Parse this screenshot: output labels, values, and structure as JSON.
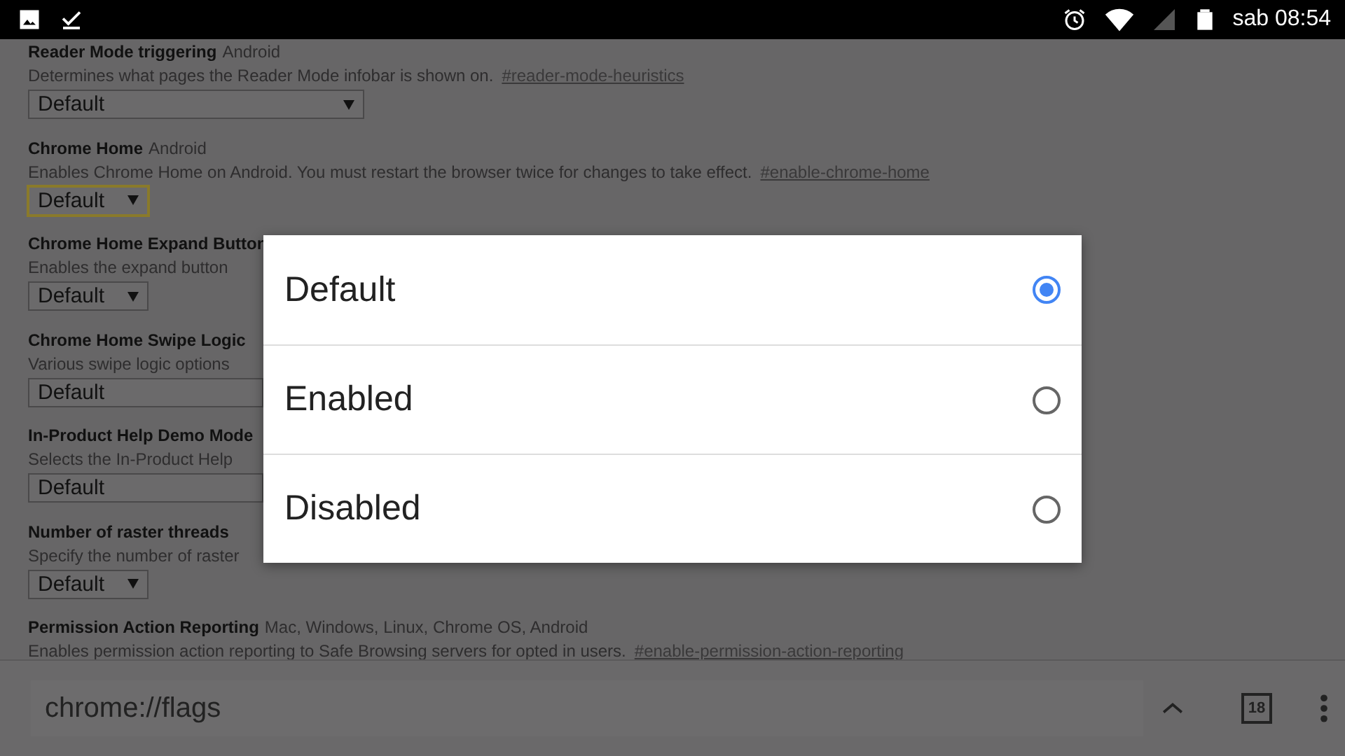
{
  "status_bar": {
    "time": "sab 08:54"
  },
  "flags": [
    {
      "title": "Reader Mode triggering",
      "platforms": "Android",
      "description": "Determines what pages the Reader Mode infobar is shown on.",
      "link": "#reader-mode-heuristics",
      "value": "Default",
      "kind": "long",
      "focused": false
    },
    {
      "title": "Chrome Home",
      "platforms": "Android",
      "description": "Enables Chrome Home on Android. You must restart the browser twice for changes to take effect.",
      "link": "#enable-chrome-home",
      "value": "Default",
      "kind": "short",
      "focused": true
    },
    {
      "title": "Chrome Home Expand Button",
      "description": "Enables the expand button",
      "value": "Default",
      "kind": "short",
      "focused": false
    },
    {
      "title": "Chrome Home Swipe Logic",
      "description": "Various swipe logic options",
      "value": "Default",
      "kind": "cut",
      "focused": false
    },
    {
      "title": "In-Product Help Demo Mode",
      "description": "Selects the In-Product Help",
      "value": "Default",
      "kind": "cut",
      "focused": false
    },
    {
      "title": "Number of raster threads",
      "description": "Specify the number of raster",
      "value": "Default",
      "kind": "short",
      "focused": false
    },
    {
      "title": "Permission Action Reporting",
      "platforms": "Mac, Windows, Linux, Chrome OS, Android",
      "description": "Enables permission action reporting to Safe Browsing servers for opted in users.",
      "link": "#enable-permission-action-reporting"
    }
  ],
  "dialog": {
    "options": [
      {
        "label": "Default",
        "selected": true
      },
      {
        "label": "Enabled",
        "selected": false
      },
      {
        "label": "Disabled",
        "selected": false
      }
    ]
  },
  "toolbar": {
    "url": "chrome://flags",
    "tab_count": "18"
  }
}
